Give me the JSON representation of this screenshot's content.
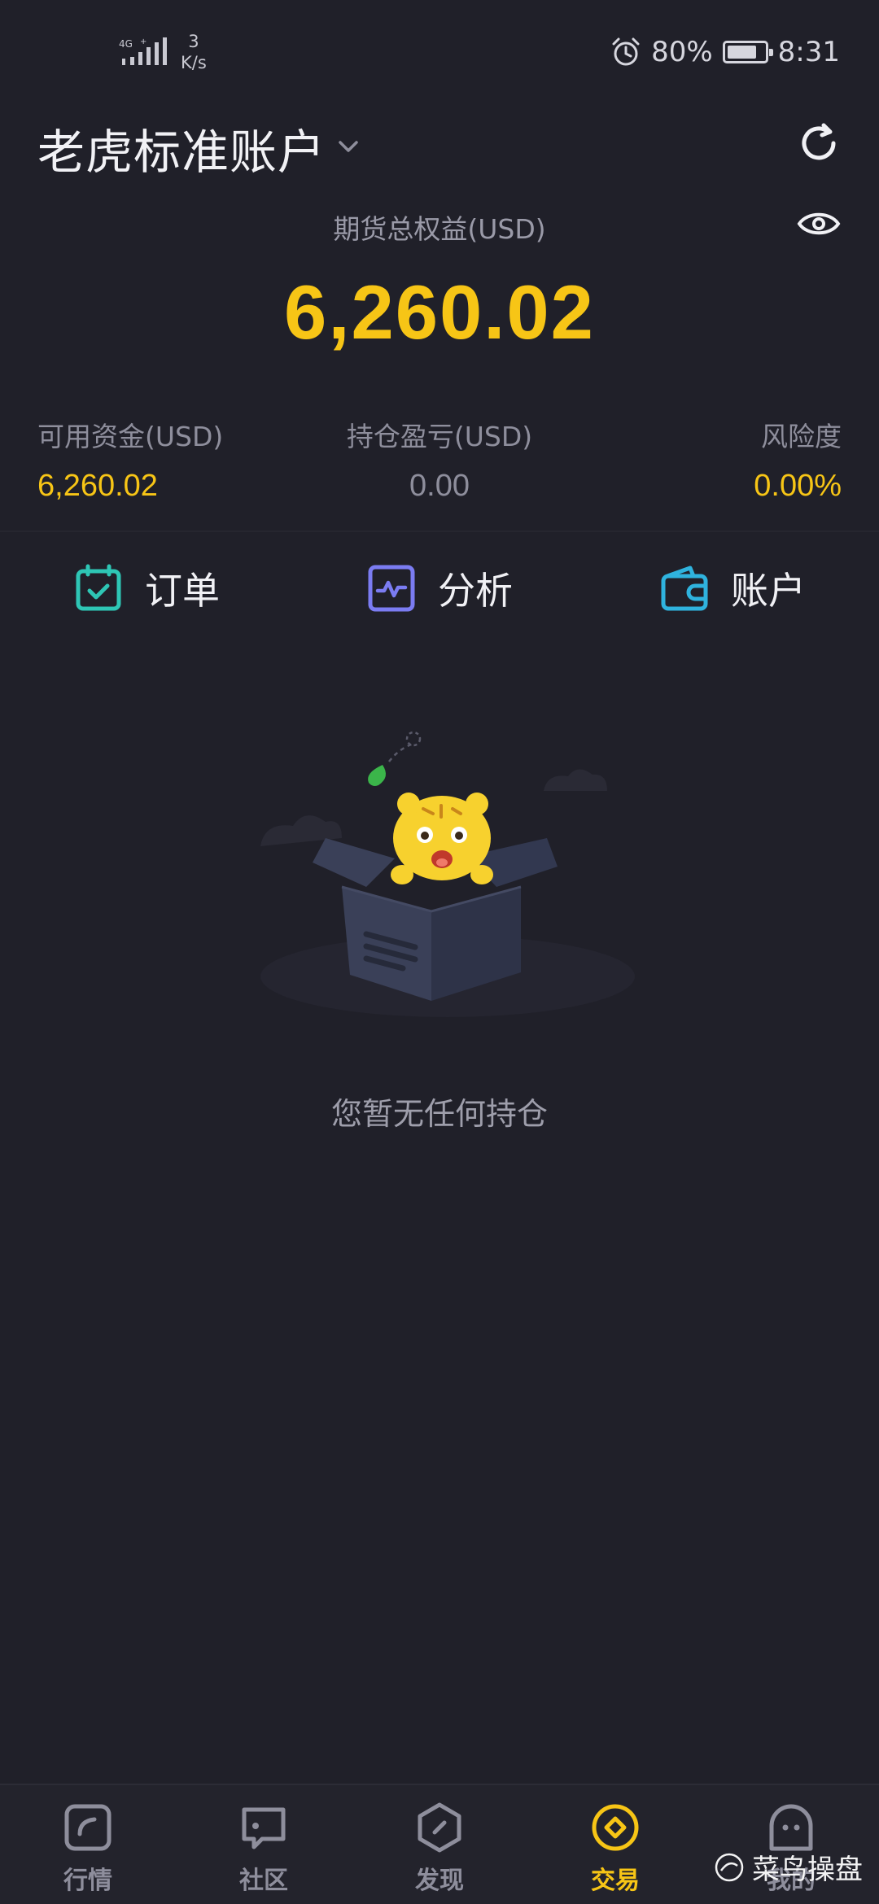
{
  "status_bar": {
    "network_type": "4G",
    "net_speed_value": "3",
    "net_speed_unit": "K/s",
    "battery_percent": "80%",
    "battery_level": 0.8,
    "time": "8:31"
  },
  "header": {
    "account_name": "老虎标准账户"
  },
  "equity": {
    "label": "期货总权益(USD)",
    "value": "6,260.02"
  },
  "stats": {
    "available": {
      "label": "可用资金(USD)",
      "value": "6,260.02"
    },
    "pnl": {
      "label": "持仓盈亏(USD)",
      "value": "0.00"
    },
    "risk": {
      "label": "风险度",
      "value": "0.00%"
    }
  },
  "actions": [
    {
      "label": "订单",
      "icon": "calendar-check-icon",
      "color": "#2ec6b5"
    },
    {
      "label": "分析",
      "icon": "pulse-chart-icon",
      "color": "#7b7cf2"
    },
    {
      "label": "账户",
      "icon": "wallet-icon",
      "color": "#2fb3de"
    }
  ],
  "empty_state": {
    "message": "您暂无任何持仓"
  },
  "bottom_nav": [
    {
      "label": "行情",
      "icon": "market-icon",
      "active": false
    },
    {
      "label": "社区",
      "icon": "community-icon",
      "active": false
    },
    {
      "label": "发现",
      "icon": "discover-icon",
      "active": false
    },
    {
      "label": "交易",
      "icon": "trade-icon",
      "active": true
    },
    {
      "label": "我的",
      "icon": "profile-icon",
      "active": false
    }
  ],
  "watermark": {
    "text": "菜鸟操盘"
  },
  "colors": {
    "background": "#202029",
    "accent_yellow": "#f7c516",
    "muted_text": "#8e8e9c"
  }
}
